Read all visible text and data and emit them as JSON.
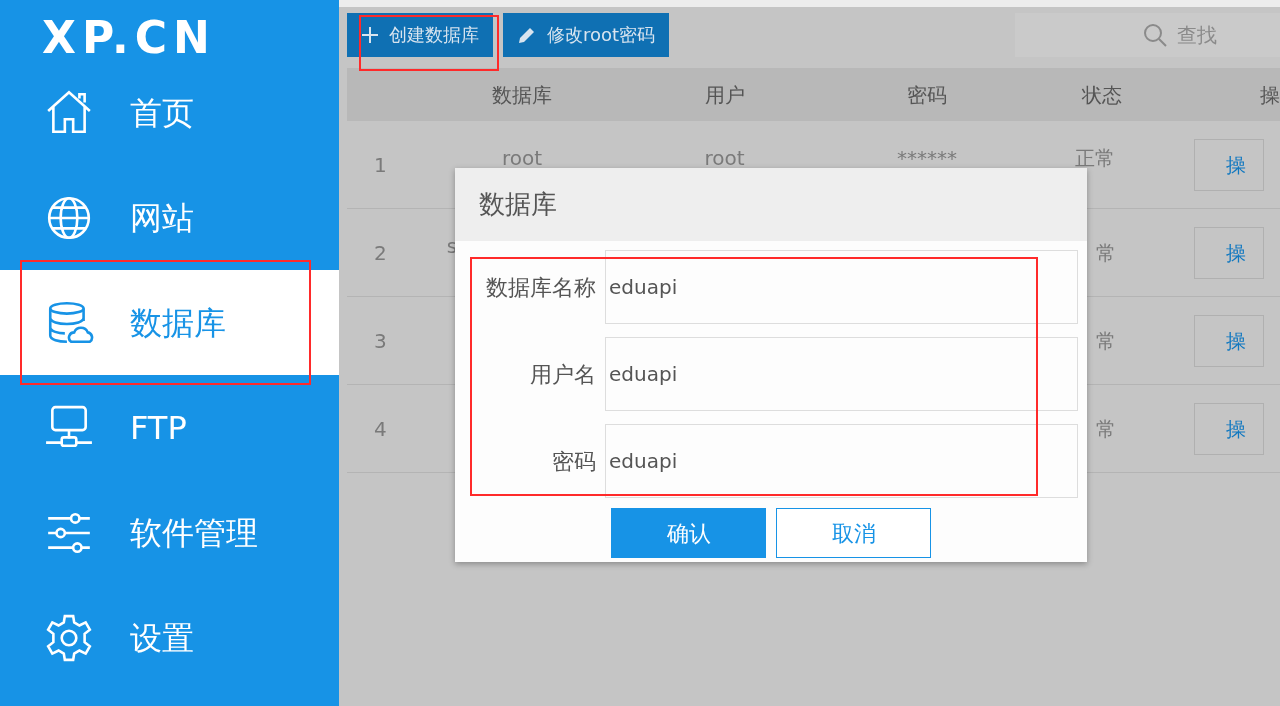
{
  "logo": "XP.CN",
  "sidebar": {
    "items": [
      {
        "label": "首页",
        "selected": false,
        "highlighted": false
      },
      {
        "label": "网站",
        "selected": false,
        "highlighted": false
      },
      {
        "label": "数据库",
        "selected": true,
        "highlighted": true
      },
      {
        "label": "FTP",
        "selected": false,
        "highlighted": false
      },
      {
        "label": "软件管理",
        "selected": false,
        "highlighted": false
      },
      {
        "label": "设置",
        "selected": false,
        "highlighted": false
      }
    ]
  },
  "toolbar": {
    "buttons": [
      {
        "label": "创建数据库",
        "highlighted": true
      },
      {
        "label": "修改root密码",
        "highlighted": false
      }
    ],
    "search": {
      "placeholder": "查找"
    }
  },
  "table": {
    "columns": [
      "数据库",
      "用户",
      "密码",
      "状态",
      "操"
    ],
    "rows": [
      {
        "index": "1",
        "database": "root",
        "user": "root",
        "password": "******",
        "status": "正常",
        "action": "操"
      },
      {
        "index": "2",
        "database": "s",
        "status": "常",
        "action": "操"
      },
      {
        "index": "3",
        "status": "常",
        "action": "操"
      },
      {
        "index": "4",
        "status": "常",
        "action": "操"
      }
    ]
  },
  "dialog": {
    "title": "数据库",
    "highlighted": true,
    "fields": [
      {
        "label": "数据库名称",
        "value": "eduapi"
      },
      {
        "label": "用户名",
        "value": "eduapi"
      },
      {
        "label": "密码",
        "value": "eduapi"
      }
    ],
    "buttons": [
      {
        "label": "确认",
        "kind": "primary"
      },
      {
        "label": "取消",
        "kind": "secondary"
      }
    ]
  }
}
